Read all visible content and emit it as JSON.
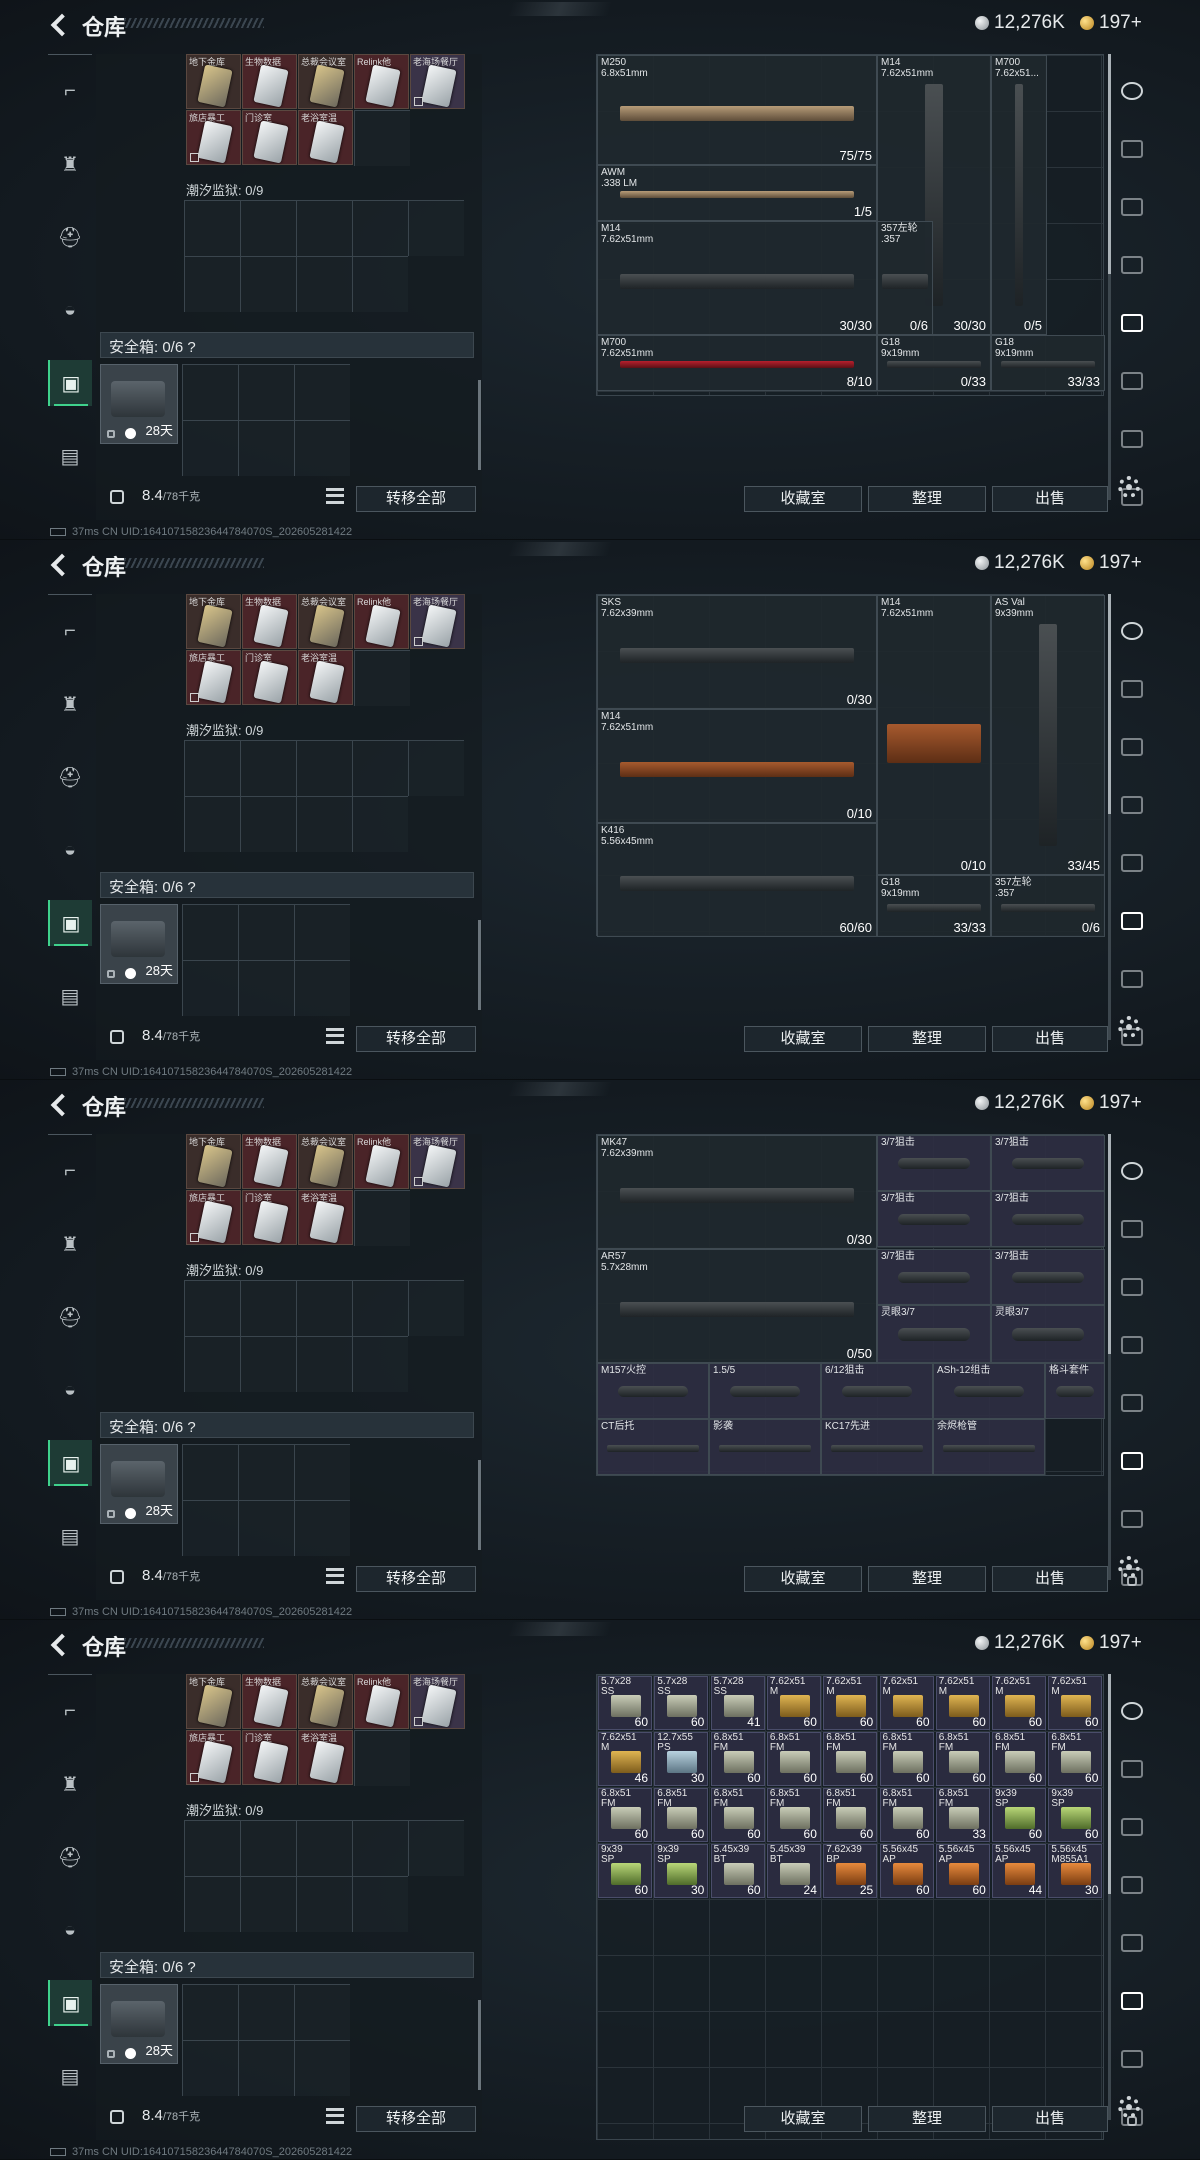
{
  "screens": [
    {
      "title": "仓库",
      "currency_silver": "12,276K",
      "currency_gold": "197+",
      "stash": {
        "top_labels": [
          "地下金库",
          "生物数据",
          "总裁会议室",
          "Relink他",
          "老海场餐厅"
        ],
        "row2_labels": [
          "旅店暴工",
          "门诊室",
          "老浴室温"
        ],
        "prison_label": "潮汐监狱: 0/9",
        "safe_label": "安全箱: 0/6 ?",
        "case_days": "28天",
        "weight": "8.4",
        "weight_max": "/78千克"
      },
      "buttons": {
        "transfer_all": "转移全部",
        "collection": "收藏室",
        "organize": "整理",
        "sell": "出售"
      },
      "status": "37ms  CN UID:16410715823644784070S_202605281422",
      "inventory": [
        {
          "name": "M250\n6.8x51mm",
          "count": "75/75",
          "style": "tan"
        },
        {
          "name": "M14\n7.62x51mm",
          "count": "30/30",
          "style": "vert"
        },
        {
          "name": "M700\n7.62x51...",
          "count": "0/5",
          "style": "vert"
        },
        {
          "name": "AWM\n.338 LM",
          "count": "1/5",
          "style": "tan"
        },
        {
          "name": "M14\n7.62x51mm",
          "count": "30/30",
          "style": ""
        },
        {
          "name": "357左轮\n.357",
          "count": "0/6",
          "style": ""
        },
        {
          "name": "M700\n7.62x51mm",
          "count": "8/10",
          "style": "redc"
        },
        {
          "name": "G18\n9x19mm",
          "count": "0/33",
          "style": ""
        },
        {
          "name": "G18\n9x19mm",
          "count": "33/33",
          "style": ""
        }
      ]
    },
    {
      "title": "仓库",
      "currency_silver": "12,276K",
      "currency_gold": "197+",
      "stash": {
        "top_labels": [
          "地下金库",
          "生物数据",
          "总裁会议室",
          "Relink他",
          "老海场餐厅"
        ],
        "row2_labels": [
          "旅店暴工",
          "门诊室",
          "老浴室温"
        ],
        "prison_label": "潮汐监狱: 0/9",
        "safe_label": "安全箱: 0/6 ?",
        "case_days": "28天",
        "weight": "8.4",
        "weight_max": "/78千克"
      },
      "buttons": {
        "transfer_all": "转移全部",
        "collection": "收藏室",
        "organize": "整理",
        "sell": "出售"
      },
      "status": "37ms  CN UID:16410715823644784070S_202605281422",
      "inventory": [
        {
          "name": "SKS\n7.62x39mm",
          "count": "0/30",
          "style": ""
        },
        {
          "name": "M14\n7.62x51mm",
          "count": "0/10",
          "style": "wood"
        },
        {
          "name": "AS Val\n9x39mm",
          "count": "33/45",
          "style": "vert"
        },
        {
          "name": "M14\n7.62x51mm",
          "count": "0/10",
          "style": "wood"
        },
        {
          "name": "K416\n5.56x45mm",
          "count": "60/60",
          "style": ""
        },
        {
          "name": "G18\n9x19mm",
          "count": "33/33",
          "style": ""
        },
        {
          "name": "357左轮\n.357",
          "count": "0/6",
          "style": ""
        }
      ]
    },
    {
      "title": "仓库",
      "currency_silver": "12,276K",
      "currency_gold": "197+",
      "stash": {
        "top_labels": [
          "地下金库",
          "生物数据",
          "总裁会议室",
          "Relink他",
          "老海场餐厅"
        ],
        "row2_labels": [
          "旅店暴工",
          "门诊室",
          "老浴室温"
        ],
        "prison_label": "潮汐监狱: 0/9",
        "safe_label": "安全箱: 0/6 ?",
        "case_days": "28天",
        "weight": "8.4",
        "weight_max": "/78千克"
      },
      "buttons": {
        "transfer_all": "转移全部",
        "collection": "收藏室",
        "organize": "整理",
        "sell": "出售"
      },
      "status": "37ms  CN UID:16410715823644784070S_202605281422",
      "inventory": [
        {
          "name": "MK47\n7.62x39mm",
          "count": "0/30",
          "style": ""
        },
        {
          "name": "3/7狙击",
          "count": "",
          "style": "scope"
        },
        {
          "name": "3/7狙击",
          "count": "",
          "style": "scope"
        },
        {
          "name": "3/7狙击",
          "count": "",
          "style": "scope"
        },
        {
          "name": "3/7狙击",
          "count": "",
          "style": "scope"
        },
        {
          "name": "AR57\n5.7x28mm",
          "count": "0/50",
          "style": ""
        },
        {
          "name": "3/7狙击",
          "count": "",
          "style": "scope"
        },
        {
          "name": "3/7狙击",
          "count": "",
          "style": "scope"
        },
        {
          "name": "灵眼3/7",
          "count": "",
          "style": "scope"
        },
        {
          "name": "灵眼3/7",
          "count": "",
          "style": "scope"
        },
        {
          "name": "M157火控",
          "count": "",
          "style": "scope"
        },
        {
          "name": "1.5/5",
          "count": "",
          "style": "scope"
        },
        {
          "name": "6/12狙击",
          "count": "",
          "style": "scope"
        },
        {
          "name": "ASh-12组击",
          "count": "",
          "style": "scope"
        },
        {
          "name": "格斗套件",
          "count": "",
          "style": "scope"
        },
        {
          "name": "CT后托",
          "count": "",
          "style": ""
        },
        {
          "name": "影袭",
          "count": "",
          "style": ""
        },
        {
          "name": "KC17先进",
          "count": "",
          "style": ""
        },
        {
          "name": "余烬枪管",
          "count": "",
          "style": ""
        }
      ]
    },
    {
      "title": "仓库",
      "currency_silver": "12,276K",
      "currency_gold": "197+",
      "stash": {
        "top_labels": [
          "地下金库",
          "生物数据",
          "总裁会议室",
          "Relink他",
          "老海场餐厅"
        ],
        "row2_labels": [
          "旅店暴工",
          "门诊室",
          "老浴室温"
        ],
        "prison_label": "潮汐监狱: 0/9",
        "safe_label": "安全箱: 0/6 ?",
        "case_days": "28天",
        "weight": "8.4",
        "weight_max": "/78千克"
      },
      "buttons": {
        "transfer_all": "转移全部",
        "collection": "收藏室",
        "organize": "整理",
        "sell": "出售"
      },
      "status": "37ms  CN UID:16410715823644784070S_202605281422",
      "ammo": [
        {
          "name": "5.7x28\nSS",
          "count": "60",
          "color": "gray"
        },
        {
          "name": "5.7x28\nSS",
          "count": "60",
          "color": "gray"
        },
        {
          "name": "5.7x28\nSS",
          "count": "41",
          "color": "gray"
        },
        {
          "name": "7.62x51\nM",
          "count": "60",
          "color": "yellow"
        },
        {
          "name": "7.62x51\nM",
          "count": "60",
          "color": "yellow"
        },
        {
          "name": "7.62x51\nM",
          "count": "60",
          "color": "yellow"
        },
        {
          "name": "7.62x51\nM",
          "count": "60",
          "color": "yellow"
        },
        {
          "name": "7.62x51\nM",
          "count": "60",
          "color": "yellow"
        },
        {
          "name": "7.62x51\nM",
          "count": "60",
          "color": "yellow"
        },
        {
          "name": "7.62x51\nM",
          "count": "46",
          "color": "yellow"
        },
        {
          "name": "12.7x55\nPS",
          "count": "30",
          "color": "blue"
        },
        {
          "name": "6.8x51\nFM",
          "count": "60",
          "color": "gray"
        },
        {
          "name": "6.8x51\nFM",
          "count": "60",
          "color": "gray"
        },
        {
          "name": "6.8x51\nFM",
          "count": "60",
          "color": "gray"
        },
        {
          "name": "6.8x51\nFM",
          "count": "60",
          "color": "gray"
        },
        {
          "name": "6.8x51\nFM",
          "count": "60",
          "color": "gray"
        },
        {
          "name": "6.8x51\nFM",
          "count": "60",
          "color": "gray"
        },
        {
          "name": "6.8x51\nFM",
          "count": "60",
          "color": "gray"
        },
        {
          "name": "6.8x51\nFM",
          "count": "60",
          "color": "gray"
        },
        {
          "name": "6.8x51\nFM",
          "count": "60",
          "color": "gray"
        },
        {
          "name": "6.8x51\nFM",
          "count": "60",
          "color": "gray"
        },
        {
          "name": "6.8x51\nFM",
          "count": "60",
          "color": "gray"
        },
        {
          "name": "6.8x51\nFM",
          "count": "60",
          "color": "gray"
        },
        {
          "name": "6.8x51\nFM",
          "count": "60",
          "color": "gray"
        },
        {
          "name": "6.8x51\nFM",
          "count": "33",
          "color": "gray"
        },
        {
          "name": "9x39\nSP",
          "count": "60",
          "color": "green"
        },
        {
          "name": "9x39\nSP",
          "count": "60",
          "color": "green"
        },
        {
          "name": "9x39\nSP",
          "count": "60",
          "color": "green"
        },
        {
          "name": "9x39\nSP",
          "count": "30",
          "color": "green"
        },
        {
          "name": "5.45x39\nBT",
          "count": "60",
          "color": "gray"
        },
        {
          "name": "5.45x39\nBT",
          "count": "24",
          "color": "gray"
        },
        {
          "name": "7.62x39\nBP",
          "count": "25",
          "color": "orange"
        },
        {
          "name": "5.56x45\nAP",
          "count": "60",
          "color": "orange"
        },
        {
          "name": "5.56x45\nAP",
          "count": "60",
          "color": "orange"
        },
        {
          "name": "5.56x45\nAP",
          "count": "44",
          "color": "orange"
        },
        {
          "name": "5.56x45\nM855A1",
          "count": "30",
          "color": "orange"
        }
      ]
    }
  ],
  "rail_icons": [
    "pistol-icon",
    "armor-icon",
    "helmet-icon",
    "backpack-icon",
    "clipboard-icon",
    "briefcase-icon"
  ],
  "accent_color": "#3fd28c"
}
